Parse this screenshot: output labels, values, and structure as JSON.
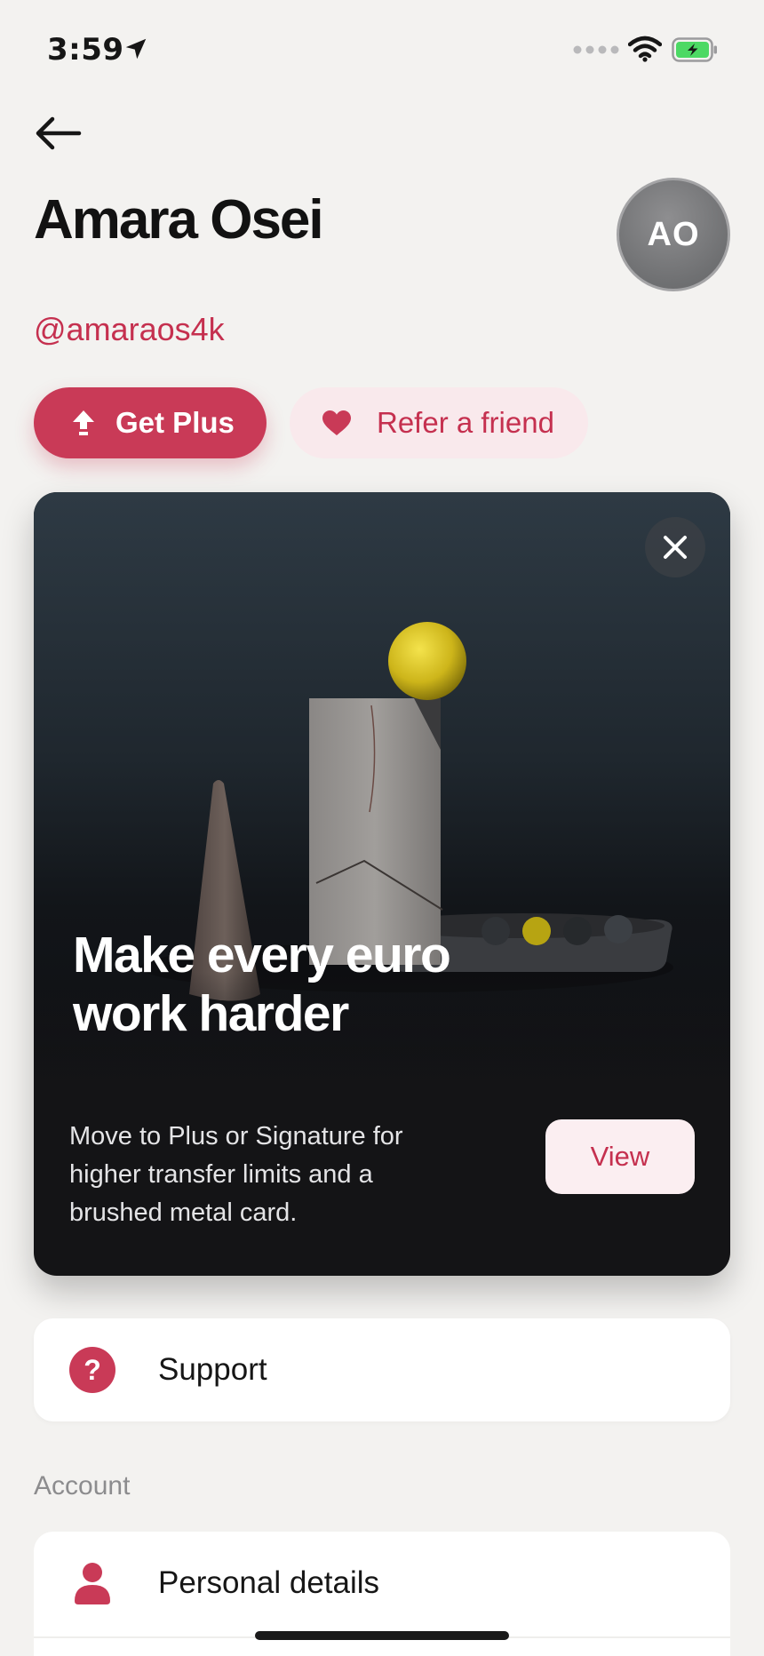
{
  "status_bar": {
    "time": "3:59"
  },
  "profile": {
    "name": "Amara Osei",
    "avatar_initials": "AO",
    "username": "@amaraos4k"
  },
  "actions": {
    "get_plus_label": "Get Plus",
    "refer_label": "Refer a friend"
  },
  "promo": {
    "title": "Make every euro work harder",
    "body": "Move to Plus or Signature for higher transfer limits and a brushed metal card.",
    "view_label": "View"
  },
  "support": {
    "label": "Support"
  },
  "account": {
    "section_label": "Account",
    "items": [
      {
        "label": "Personal details",
        "icon": "person-icon"
      }
    ]
  },
  "colors": {
    "accent": "#c93a57",
    "accent_soft": "#f9e9ec",
    "background": "#f3f2f0",
    "card_dark": "#141416"
  }
}
